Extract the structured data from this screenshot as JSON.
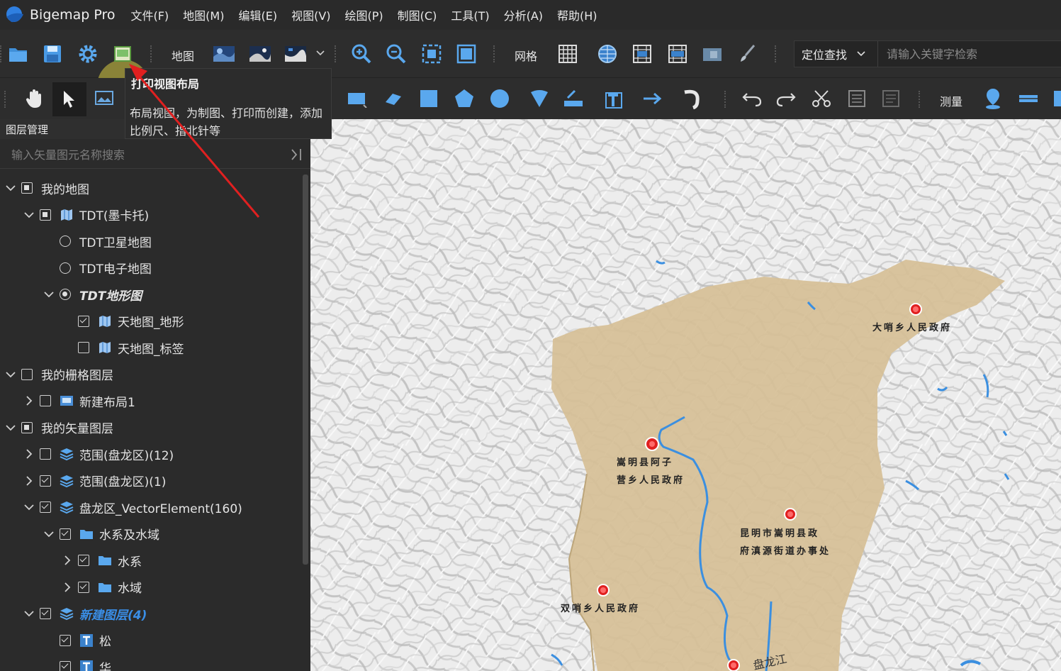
{
  "app": {
    "title": "Bigemap Pro"
  },
  "menu": [
    "文件(F)",
    "地图(M)",
    "编辑(E)",
    "视图(V)",
    "绘图(P)",
    "制图(C)",
    "工具(T)",
    "分析(A)",
    "帮助(H)"
  ],
  "toolbar": {
    "map_label": "地图",
    "grid_label": "网格",
    "measure_label": "测量",
    "locate_dropdown": "定位查找",
    "search_placeholder": "请输入关键字检索"
  },
  "tooltip": {
    "title": "打印视图布局",
    "description": "布局视图，为制图、打印而创建，添加比例尺、指北针等"
  },
  "layer_panel": {
    "title": "图层管理",
    "search_placeholder": "输入矢量图元名称搜索"
  },
  "tree": [
    {
      "label": "我的地图",
      "level": 0,
      "arrow": "down",
      "control": "partial"
    },
    {
      "label": "TDT(墨卡托)",
      "level": 1,
      "arrow": "down",
      "control": "partial",
      "icon": "map-book-icon"
    },
    {
      "label": "TDT卫星地图",
      "level": 2,
      "arrow": "none",
      "control": "radio"
    },
    {
      "label": "TDT电子地图",
      "level": 2,
      "arrow": "none",
      "control": "radio"
    },
    {
      "label": "TDT地形图",
      "level": 2,
      "arrow": "down",
      "control": "radio-on",
      "style": "italic"
    },
    {
      "label": "天地图_地形",
      "level": 3,
      "arrow": "none",
      "control": "checked",
      "icon": "map-book-icon"
    },
    {
      "label": "天地图_标签",
      "level": 3,
      "arrow": "none",
      "control": "unchecked",
      "icon": "map-book-icon"
    },
    {
      "label": "我的栅格图层",
      "level": 0,
      "arrow": "down",
      "control": "unchecked"
    },
    {
      "label": "新建布局1",
      "level": 1,
      "arrow": "right",
      "control": "unchecked",
      "icon": "layout-icon"
    },
    {
      "label": "我的矢量图层",
      "level": 0,
      "arrow": "down",
      "control": "partial"
    },
    {
      "label": "范围(盘龙区)(12)",
      "level": 1,
      "arrow": "right",
      "control": "unchecked",
      "icon": "layers-icon"
    },
    {
      "label": "范围(盘龙区)(1)",
      "level": 1,
      "arrow": "right",
      "control": "checked",
      "icon": "layers-icon"
    },
    {
      "label": "盘龙区_VectorElement(160)",
      "level": 1,
      "arrow": "down",
      "control": "checked",
      "icon": "layers-icon"
    },
    {
      "label": "水系及水域",
      "level": 2,
      "arrow": "down",
      "control": "checked",
      "icon": "folder-icon"
    },
    {
      "label": "水系",
      "level": 3,
      "arrow": "right",
      "control": "checked",
      "icon": "folder-icon"
    },
    {
      "label": "水域",
      "level": 3,
      "arrow": "right",
      "control": "checked",
      "icon": "folder-icon"
    },
    {
      "label": "新建图层(4)",
      "level": 1,
      "arrow": "down",
      "control": "checked",
      "icon": "layers-icon",
      "style": "blue-italic"
    },
    {
      "label": "松",
      "level": 2,
      "arrow": "none",
      "control": "checked",
      "icon": "text-icon"
    },
    {
      "label": "华",
      "level": 2,
      "arrow": "none",
      "control": "checked",
      "icon": "text-icon"
    }
  ],
  "map_labels": {
    "label_1": "大哨乡人民政府",
    "label_2a": "嵩明县阿子",
    "label_2b": "营乡人民政府",
    "label_3a": "昆明市嵩明县政",
    "label_3b": "府滇源街道办事处",
    "label_4": "双哨乡人民政府",
    "river": "盘龙江"
  },
  "colors": {
    "region_fill": "#d6bf96",
    "river": "#3b8fe0",
    "poi": "#e02020",
    "highlight": "#b8a840",
    "arrow": "#e02020"
  }
}
